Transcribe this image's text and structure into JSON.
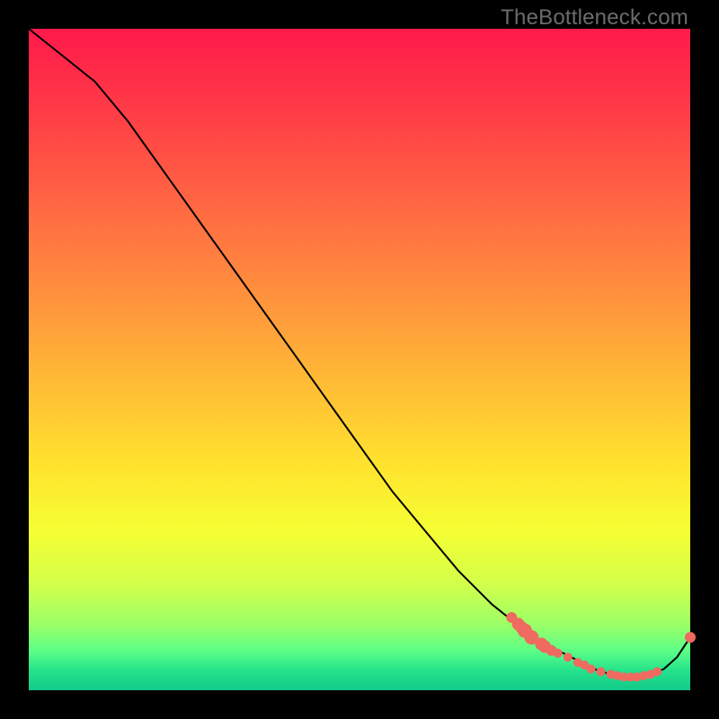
{
  "watermark": "TheBottleneck.com",
  "colors": {
    "dot": "#ef6a61",
    "curve": "#000000",
    "frame_bg": "#000000"
  },
  "chart_data": {
    "type": "line",
    "title": "",
    "xlabel": "",
    "ylabel": "",
    "xlim": [
      0,
      100
    ],
    "ylim": [
      0,
      100
    ],
    "grid": false,
    "legend": false,
    "annotations": [
      {
        "text": "TheBottleneck.com",
        "position": "top-right"
      }
    ],
    "series": [
      {
        "name": "curve",
        "x": [
          0,
          5,
          10,
          15,
          20,
          25,
          30,
          35,
          40,
          45,
          50,
          55,
          60,
          65,
          70,
          75,
          80,
          82,
          84,
          86,
          88,
          90,
          92,
          94,
          96,
          98,
          100
        ],
        "y": [
          100,
          96,
          92,
          86,
          79,
          72,
          65,
          58,
          51,
          44,
          37,
          30,
          24,
          18,
          13,
          9,
          6,
          5,
          4,
          3,
          2.4,
          2,
          2,
          2.4,
          3.2,
          5,
          8
        ]
      }
    ],
    "points": [
      {
        "x": 73,
        "y": 11
      },
      {
        "x": 74,
        "y": 10
      },
      {
        "x": 74.5,
        "y": 9.5
      },
      {
        "x": 75,
        "y": 9
      },
      {
        "x": 76,
        "y": 8
      },
      {
        "x": 77.5,
        "y": 7
      },
      {
        "x": 78,
        "y": 6.6
      },
      {
        "x": 79,
        "y": 6
      },
      {
        "x": 80,
        "y": 5.6
      },
      {
        "x": 81.5,
        "y": 5
      },
      {
        "x": 83,
        "y": 4.2
      },
      {
        "x": 84,
        "y": 3.8
      },
      {
        "x": 85,
        "y": 3.2
      },
      {
        "x": 86.5,
        "y": 2.8
      },
      {
        "x": 88,
        "y": 2.4
      },
      {
        "x": 89,
        "y": 2.2
      },
      {
        "x": 90,
        "y": 2
      },
      {
        "x": 91,
        "y": 2
      },
      {
        "x": 92,
        "y": 2
      },
      {
        "x": 93,
        "y": 2.2
      },
      {
        "x": 94,
        "y": 2.4
      },
      {
        "x": 95,
        "y": 2.8
      },
      {
        "x": 100,
        "y": 8
      }
    ],
    "point_sizes_note": "radii in px at 736×736 canvas scale",
    "point_radii": [
      6,
      7,
      7,
      8,
      8,
      7,
      7,
      6,
      5,
      5,
      5,
      5,
      5,
      5,
      5,
      5,
      5,
      5,
      5,
      5,
      5,
      5,
      6
    ]
  }
}
